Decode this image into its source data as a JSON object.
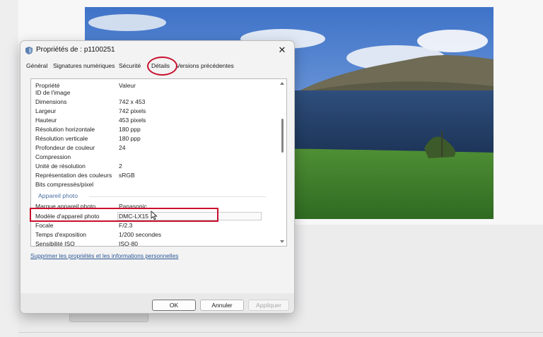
{
  "dialog": {
    "title": "Propriétés de : p1100251",
    "close_glyph": "✕",
    "tabs": [
      "Général",
      "Signatures numériques",
      "Sécurité",
      "Détails",
      "Versions précédentes"
    ],
    "active_tab": "Détails",
    "columns": {
      "property": "Propriété",
      "value": "Valeur"
    },
    "image_rows": [
      {
        "k": "ID de l'image",
        "v": ""
      },
      {
        "k": "Dimensions",
        "v": "742 x 453"
      },
      {
        "k": "Largeur",
        "v": "742 pixels"
      },
      {
        "k": "Hauteur",
        "v": "453 pixels"
      },
      {
        "k": "Résolution horizontale",
        "v": "180 ppp"
      },
      {
        "k": "Résolution verticale",
        "v": "180 ppp"
      },
      {
        "k": "Profondeur de couleur",
        "v": "24"
      },
      {
        "k": "Compression",
        "v": ""
      },
      {
        "k": "Unité de résolution",
        "v": "2"
      },
      {
        "k": "Représentation des couleurs",
        "v": "sRGB"
      },
      {
        "k": "Bits compressés/pixel",
        "v": ""
      }
    ],
    "camera_section": "Appareil photo",
    "camera_rows": [
      {
        "k": "Marque appareil photo",
        "v": "Panasonic"
      },
      {
        "k": "Modèle d'appareil photo",
        "v": "DMC-LX15"
      },
      {
        "k": "Focale",
        "v": "F/2.3"
      },
      {
        "k": "Temps d'exposition",
        "v": "1/200 secondes"
      },
      {
        "k": "Sensibilité ISO",
        "v": "ISO-80"
      }
    ],
    "remove_link": "Supprimer les propriétés et les informations personnelles",
    "buttons": {
      "ok": "OK",
      "cancel": "Annuler",
      "apply": "Appliquer"
    }
  },
  "colors": {
    "annotation": "#c8102e",
    "link": "#2b5797",
    "section": "#4a6ea0"
  }
}
